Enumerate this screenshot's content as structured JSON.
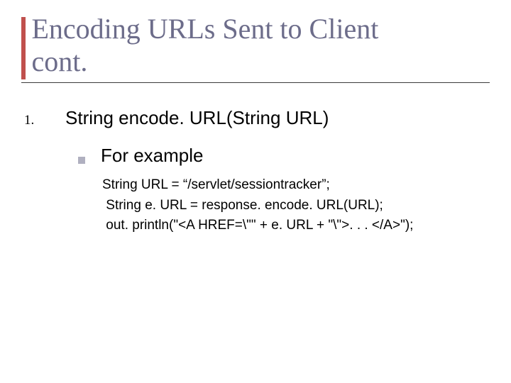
{
  "title": {
    "line1": "Encoding URLs Sent to Client",
    "line2": "cont."
  },
  "list": {
    "marker": "1.",
    "text": "String encode. URL(String URL)"
  },
  "sub": {
    "text": "For example"
  },
  "code": {
    "l1": "String URL = “/servlet/sessiontracker”;",
    "l2": " String e. URL = response. encode. URL(URL);",
    "l3": " out. println(\"<A HREF=\\\"\" + e. URL + \"\\\">. . . </A>\");"
  }
}
